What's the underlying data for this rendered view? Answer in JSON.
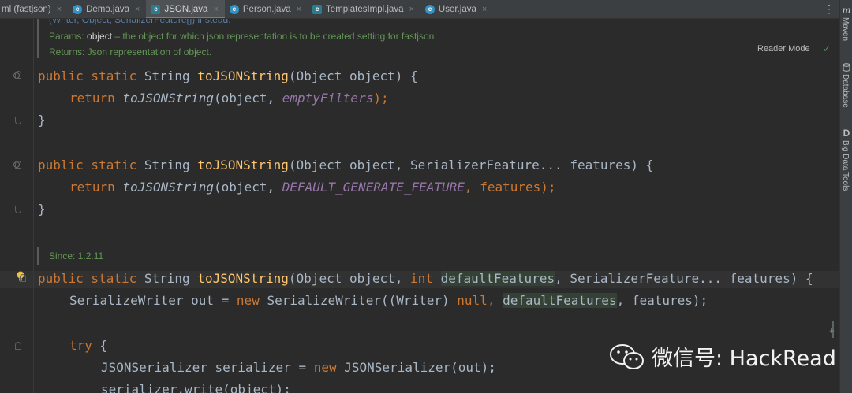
{
  "tabs": [
    {
      "label": "ml (fastjson)",
      "icon": "none",
      "active": false
    },
    {
      "label": "Demo.java",
      "icon": "class-icon",
      "active": false
    },
    {
      "label": "JSON.java",
      "icon": "class-icon",
      "active": true
    },
    {
      "label": "Person.java",
      "icon": "class-icon",
      "active": false
    },
    {
      "label": "TemplatesImpl.java",
      "icon": "class-icon",
      "active": false
    },
    {
      "label": "User.java",
      "icon": "class-icon",
      "active": false
    }
  ],
  "tab_close_glyph": "×",
  "tab_menu_glyph": "⋮",
  "tool_windows": {
    "maven_icon": "m",
    "maven": "Maven",
    "database": "Database",
    "bigdata_icon": "D",
    "bigdata": "Big Data Tools"
  },
  "editor": {
    "reader_mode": "Reader Mode",
    "doc1": {
      "cut_line": "(Writer, Object, SerializerFeature[]) instead.",
      "params_label": "Params:",
      "params_name": "object",
      "params_text": " – the object for which json representation is to be created setting for fastjson",
      "returns": "Returns: Json representation of object."
    },
    "method1": {
      "mods": "public static",
      "type": "String",
      "name": "toJSONString",
      "params": "(Object object) {",
      "ret_kw": "return",
      "ret_call": "toJSONString",
      "ret_arg1": "(object, ",
      "ret_arg2": "emptyFilters",
      "ret_end": ");",
      "close": "}"
    },
    "method2": {
      "mods": "public static",
      "type": "String",
      "name": "toJSONString",
      "params": "(Object object, SerializerFeature... features) {",
      "ret_kw": "return",
      "ret_call": "toJSONString",
      "ret_arg1": "(object, ",
      "ret_arg2": "DEFAULT_GENERATE_FEATURE",
      "ret_end": ", features);",
      "close": "}"
    },
    "since": "Since: 1.2.11",
    "method3": {
      "mods": "public static",
      "type": "String",
      "name": "toJSONString",
      "p1": "(Object object, ",
      "int_kw": "int",
      "p2": "defaultFeatures",
      "p3": ", SerializerFeature... features) {",
      "l2a": "SerializeWriter out = ",
      "new_kw": "new",
      "l2b": " SerializeWriter((Writer) ",
      "null_kw": "null",
      "l2c": ", ",
      "l2d": "defaultFeatures",
      "l2e": ", features);",
      "try_kw": "try",
      "try_brace": " {",
      "l4a": "JSONSerializer serializer = ",
      "l4b": " JSONSerializer(out);",
      "l5": "serializer.write(object);"
    }
  },
  "watermark": {
    "text": "微信号: HackRead"
  },
  "colors": {
    "keyword": "#cc7832",
    "method": "#ffc66d",
    "static_field": "#9876aa",
    "doc": "#629755",
    "text": "#a9b7c6",
    "accent": "#4a88c7"
  }
}
